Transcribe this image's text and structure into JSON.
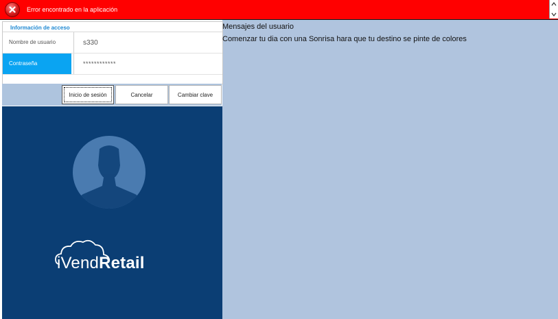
{
  "error_bar": {
    "message": "Error encontrado en la aplicación",
    "icon": "error-x-icon",
    "color": "#ff0000"
  },
  "login": {
    "section_title": "Información de acceso",
    "username_label": "Nombre de usuario",
    "username_value": "s330",
    "password_label": "Contraseña",
    "password_value": "************"
  },
  "buttons": {
    "login": "Inicio de sesión",
    "cancel": "Cancelar",
    "change_password": "Cambiar clave"
  },
  "brand": {
    "logo_light": "iVend",
    "logo_bold": "Retail",
    "background": "#0b3e74"
  },
  "messages": {
    "title": "Mensajes del usuario",
    "body": "Comenzar tu dia con una Sonrisa hara que tu destino se pinte de colores"
  },
  "colors": {
    "accent": "#0aa4f2",
    "right_panel": "#b0c4de"
  }
}
